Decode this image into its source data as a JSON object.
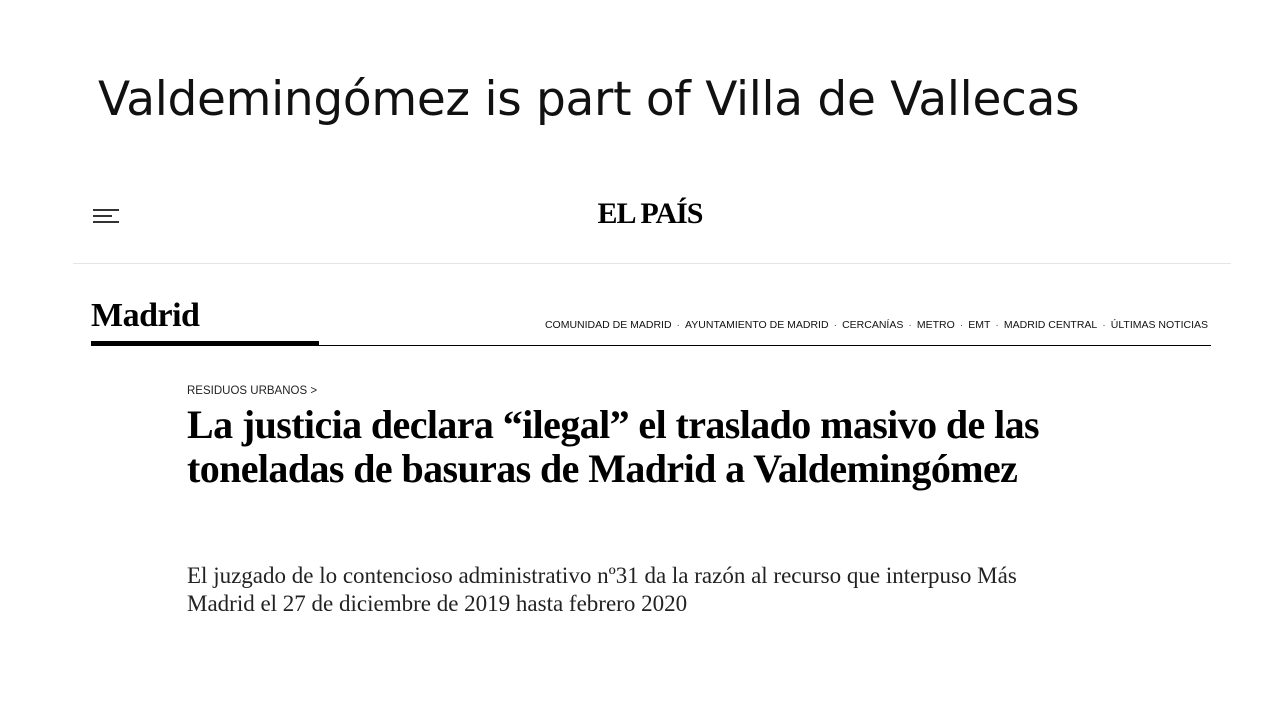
{
  "slide": {
    "title": "Valdemingómez is part of Villa de Vallecas"
  },
  "header": {
    "menu_icon": "hamburger-menu-icon",
    "brand": "EL PAÍS"
  },
  "section": {
    "name": "Madrid",
    "nav_links": [
      "COMUNIDAD DE MADRID",
      "AYUNTAMIENTO DE MADRID",
      "CERCANÍAS",
      "METRO",
      "EMT",
      "MADRID CENTRAL",
      "ÚLTIMAS NOTICIAS"
    ],
    "separator": "·"
  },
  "article": {
    "kicker": "RESIDUOS URBANOS >",
    "headline": "La justicia declara “ilegal” el traslado masivo de las toneladas de basuras de Madrid a Valdemingómez",
    "dek": "El juzgado de lo contencioso administrativo nº31 da la razón al recurso que interpuso Más Madrid el 27 de diciembre de 2019 hasta febrero 2020"
  },
  "colors": {
    "text": "#000000",
    "divider": "#e6e6e6",
    "background": "#ffffff"
  }
}
